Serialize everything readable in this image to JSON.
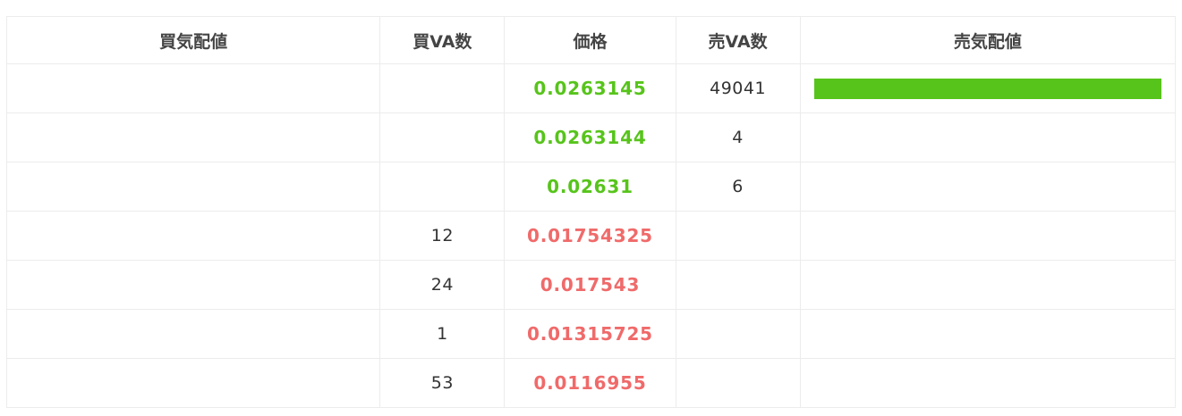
{
  "headers": {
    "buy_depth": "買気配値",
    "buy_qty": "買VA数",
    "price": "価格",
    "sell_qty": "売VA数",
    "sell_depth": "売気配値"
  },
  "colors": {
    "ask": "#57c41b",
    "bid": "#f06a6a",
    "sell_bar": "#57c41b"
  },
  "rows": [
    {
      "side": "ask",
      "buy_qty": "",
      "price": "0.0263145",
      "sell_qty": "49041",
      "sell_depth": 1.0,
      "buy_depth": 0
    },
    {
      "side": "ask",
      "buy_qty": "",
      "price": "0.0263144",
      "sell_qty": "4",
      "sell_depth": 0,
      "buy_depth": 0
    },
    {
      "side": "ask",
      "buy_qty": "",
      "price": "0.02631",
      "sell_qty": "6",
      "sell_depth": 0,
      "buy_depth": 0
    },
    {
      "side": "bid",
      "buy_qty": "12",
      "price": "0.01754325",
      "sell_qty": "",
      "sell_depth": 0,
      "buy_depth": 0
    },
    {
      "side": "bid",
      "buy_qty": "24",
      "price": "0.017543",
      "sell_qty": "",
      "sell_depth": 0,
      "buy_depth": 0
    },
    {
      "side": "bid",
      "buy_qty": "1",
      "price": "0.01315725",
      "sell_qty": "",
      "sell_depth": 0,
      "buy_depth": 0
    },
    {
      "side": "bid",
      "buy_qty": "53",
      "price": "0.0116955",
      "sell_qty": "",
      "sell_depth": 0,
      "buy_depth": 0
    }
  ]
}
